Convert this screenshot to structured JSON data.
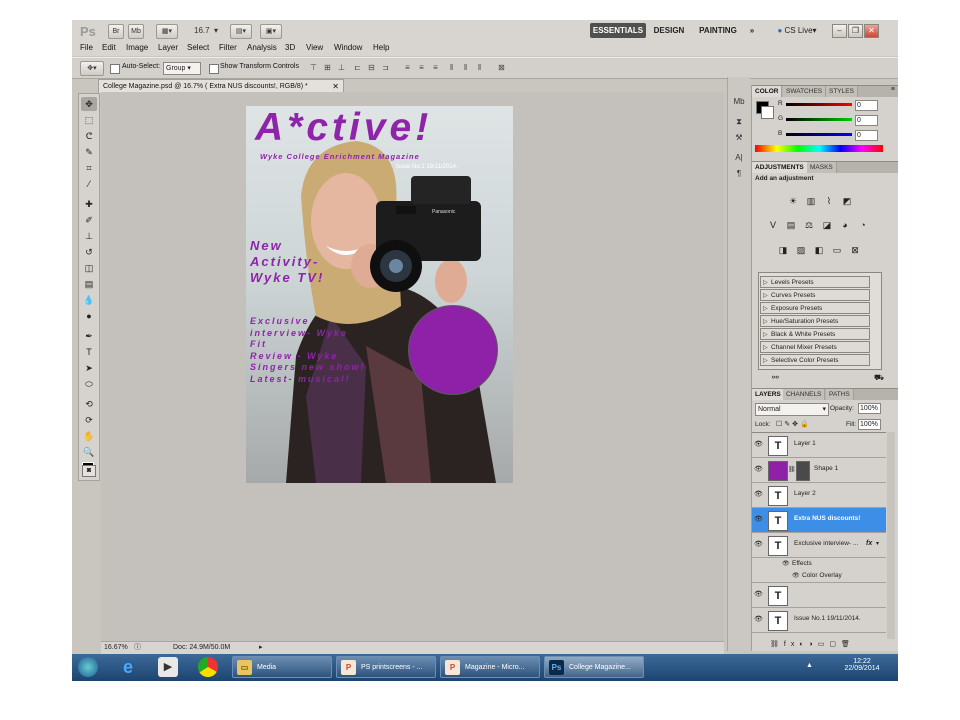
{
  "appbar": {
    "logo": "Ps",
    "zoom": "16.7",
    "workspaces": [
      "ESSENTIALS",
      "DESIGN",
      "PAINTING"
    ],
    "more": "»",
    "cslive": "CS Live"
  },
  "menus": [
    "File",
    "Edit",
    "Image",
    "Layer",
    "Select",
    "Filter",
    "Analysis",
    "3D",
    "View",
    "Window",
    "Help"
  ],
  "options": {
    "auto_select_label": "Auto-Select:",
    "auto_select_value": "Group",
    "show_transform_label": "Show Transform Controls"
  },
  "document": {
    "tab_title": "College Magazine.psd @ 16.7% ( Extra NUS discounts!, RGB/8) *",
    "zoom": "16.67%",
    "doc_size": "Doc: 24.9M/50.0M"
  },
  "magazine": {
    "masthead": "A*ctive!",
    "subtitle": "Wyke College Enrichment Magazine",
    "issue": "Issue No.1 19/11/2014.",
    "new_line1": "New",
    "new_line2": "Activity-",
    "new_line3": "Wyke TV!",
    "excl_lines": [
      "Exclusive",
      "interview- Wyke",
      "Fit",
      "Review - Wyke",
      "Singers new show!",
      "Latest- musical!"
    ],
    "camera_brand": "Panasonic",
    "circle_color": "#8f21a8",
    "text_color": "#8e24aa"
  },
  "color_panel": {
    "tabs": [
      "COLOR",
      "SWATCHES",
      "STYLES"
    ],
    "channels": [
      {
        "label": "R",
        "value": "0"
      },
      {
        "label": "G",
        "value": "0"
      },
      {
        "label": "B",
        "value": "0"
      }
    ]
  },
  "adjustments_panel": {
    "tabs": [
      "ADJUSTMENTS",
      "MASKS"
    ],
    "heading": "Add an adjustment",
    "presets": [
      "Levels Presets",
      "Curves Presets",
      "Exposure Presets",
      "Hue/Saturation Presets",
      "Black & White Presets",
      "Channel Mixer Presets",
      "Selective Color Presets"
    ]
  },
  "layers_panel": {
    "tabs": [
      "LAYERS",
      "CHANNELS",
      "PATHS"
    ],
    "blend_mode": "Normal",
    "opacity_label": "Opacity:",
    "opacity": "100%",
    "lock_label": "Lock:",
    "fill_label": "Fill:",
    "fill": "100%",
    "layers": [
      {
        "name": "Layer 1",
        "type": "text"
      },
      {
        "name": "Shape 1",
        "type": "shape"
      },
      {
        "name": "Layer 2",
        "type": "text"
      },
      {
        "name": "Extra NUS  discounts!",
        "type": "text",
        "selected": true
      },
      {
        "name": "Exclusive interview- ...",
        "type": "text",
        "fx": "fx"
      },
      {
        "name": "",
        "type": "text"
      },
      {
        "name": "Issue No.1 19/11/2014.",
        "type": "text"
      }
    ],
    "effects_label": "Effects",
    "color_overlay_label": "Color Overlay"
  },
  "taskbar": {
    "items": [
      "Media",
      "PS printscreens - ...",
      "Magazine - Micro...",
      "College Magazine..."
    ],
    "time": "12:22",
    "date": "22/09/2014"
  }
}
